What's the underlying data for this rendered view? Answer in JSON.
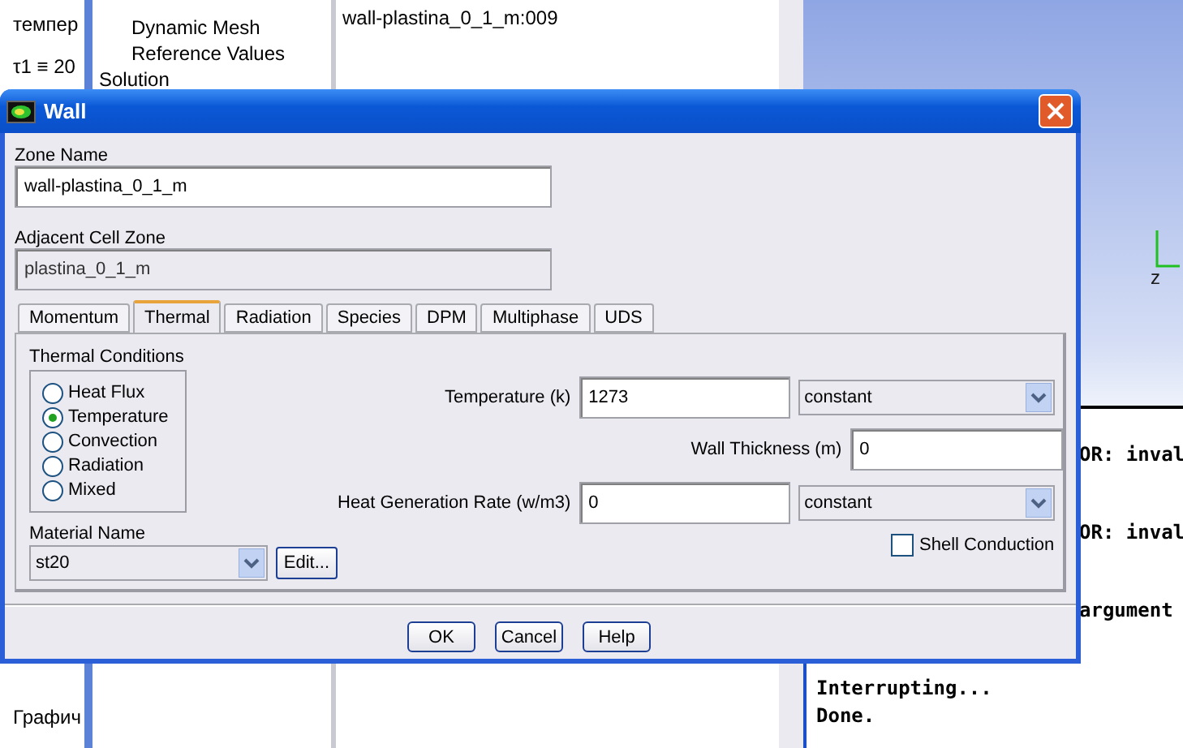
{
  "background": {
    "left_panel": {
      "lines": [
        "темпер",
        "τ1 ≡ 20",
        "Графич"
      ]
    },
    "tree": {
      "items": [
        {
          "label": "Dynamic Mesh",
          "kind": "child"
        },
        {
          "label": "Reference Values",
          "kind": "child"
        },
        {
          "label": "Solution",
          "kind": "root"
        }
      ]
    },
    "zone_list": {
      "items": [
        "wall-plastina_0_1_m:009"
      ]
    },
    "graphics": {
      "axis_label": "z"
    },
    "console": {
      "tail_lines": [
        "OR: inval",
        "OR: inval",
        "argument"
      ],
      "lines": [
        "Interrupting...",
        "Done."
      ]
    }
  },
  "dialog": {
    "title": "Wall",
    "zone_name": {
      "label": "Zone Name",
      "value": "wall-plastina_0_1_m"
    },
    "adjacent_cell_zone": {
      "label": "Adjacent Cell Zone",
      "value": "plastina_0_1_m"
    },
    "tabs": [
      {
        "label": "Momentum",
        "selected": false
      },
      {
        "label": "Thermal",
        "selected": true
      },
      {
        "label": "Radiation",
        "selected": false
      },
      {
        "label": "Species",
        "selected": false
      },
      {
        "label": "DPM",
        "selected": false
      },
      {
        "label": "Multiphase",
        "selected": false
      },
      {
        "label": "UDS",
        "selected": false
      }
    ],
    "thermal_conditions": {
      "label": "Thermal Conditions",
      "options": [
        {
          "label": "Heat Flux",
          "selected": false
        },
        {
          "label": "Temperature",
          "selected": true
        },
        {
          "label": "Convection",
          "selected": false
        },
        {
          "label": "Radiation",
          "selected": false
        },
        {
          "label": "Mixed",
          "selected": false
        }
      ]
    },
    "material": {
      "label": "Material Name",
      "value": "st20",
      "edit_button": "Edit..."
    },
    "temperature": {
      "label": "Temperature (k)",
      "value": "1273",
      "method": "constant"
    },
    "wall_thickness": {
      "label": "Wall Thickness (m)",
      "value": "0"
    },
    "heat_generation": {
      "label": "Heat Generation Rate (w/m3)",
      "value": "0",
      "method": "constant"
    },
    "shell_conduction": {
      "label": "Shell Conduction",
      "checked": false
    },
    "buttons": [
      "OK",
      "Cancel",
      "Help"
    ]
  }
}
